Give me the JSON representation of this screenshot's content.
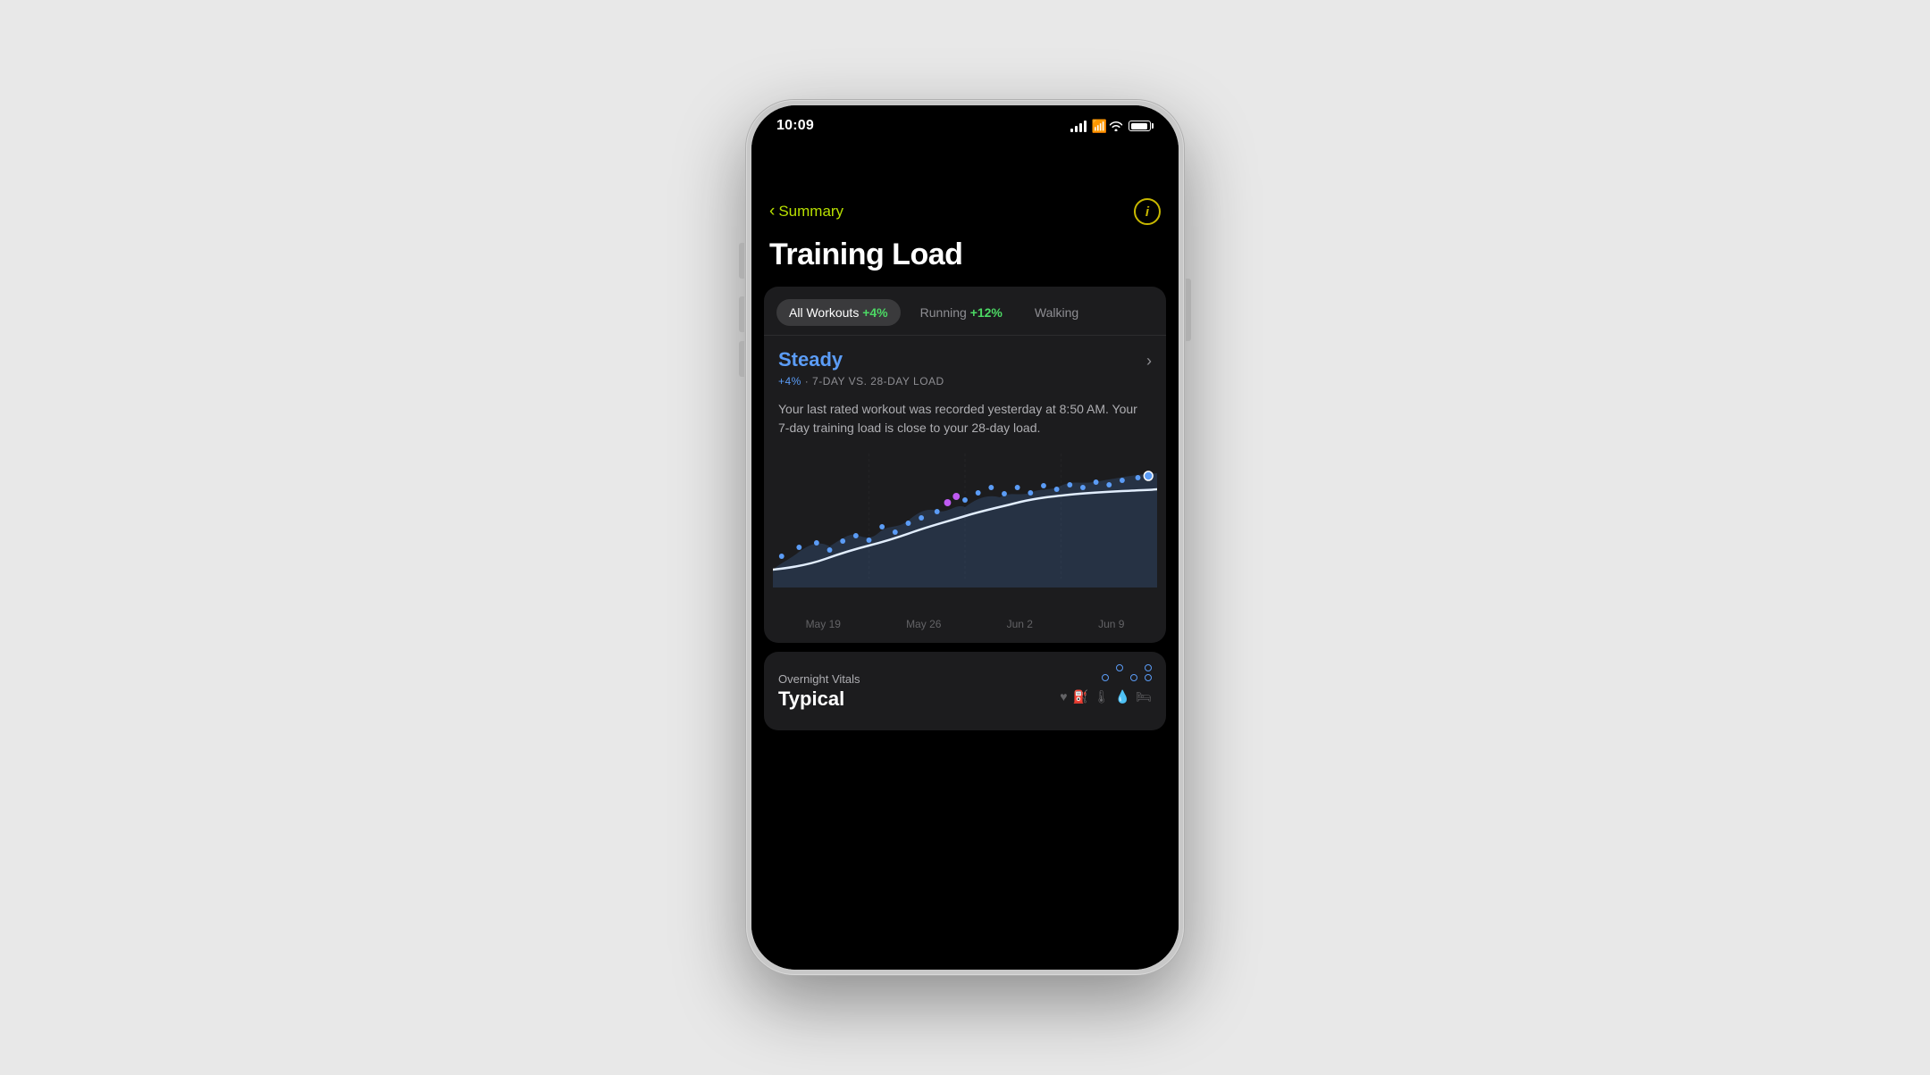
{
  "phone": {
    "status_bar": {
      "time": "10:09",
      "signal_label": "signal",
      "wifi_label": "wifi",
      "battery_label": "battery"
    }
  },
  "nav": {
    "back_label": "Summary",
    "info_label": "i"
  },
  "page": {
    "title": "Training Load"
  },
  "tabs": [
    {
      "label": "All Workouts",
      "badge": "+4%",
      "active": true
    },
    {
      "label": "Running",
      "badge": "+12%",
      "active": false
    },
    {
      "label": "Walking",
      "badge": "",
      "active": false
    }
  ],
  "status_card": {
    "title": "Steady",
    "subtitle_prefix": "+4%",
    "subtitle_middle": " · ",
    "subtitle_suffix": "7-DAY VS. 28-DAY LOAD",
    "description": "Your last rated workout was recorded yesterday at 8:50 AM. Your 7-day training load is close to your 28-day load.",
    "chevron": "›"
  },
  "chart": {
    "dates": [
      "May 19",
      "May 26",
      "Jun 2",
      "Jun 9"
    ]
  },
  "vitals": {
    "label": "Overnight Vitals",
    "status": "Typical"
  },
  "colors": {
    "accent_green": "#b8e000",
    "accent_blue": "#5b9cf6",
    "accent_purple": "#bf5af2",
    "card_bg": "#1c1c1e",
    "text_secondary": "#aeaeb2",
    "text_muted": "#636366"
  }
}
